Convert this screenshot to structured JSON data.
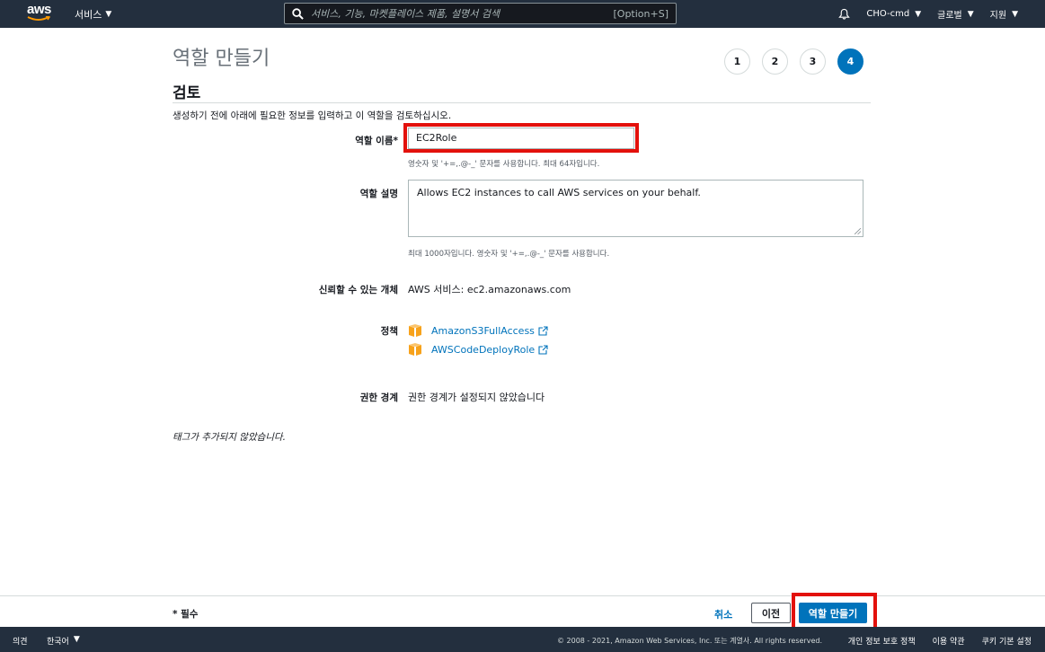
{
  "topnav": {
    "logo_text": "aws",
    "services_label": "서비스",
    "search_placeholder": "서비스, 기능, 마켓플레이스 제품, 설명서 검색",
    "search_shortcut": "[Option+S]",
    "account": "CHO-cmd",
    "region": "글로벌",
    "support": "지원"
  },
  "page": {
    "title": "역할 만들기",
    "steps": [
      "1",
      "2",
      "3",
      "4"
    ],
    "active_step": "4",
    "section_title": "검토",
    "intro": "생성하기 전에 아래에 필요한 정보를 입력하고 이 역할을 검토하십시오."
  },
  "form": {
    "role_name_label": "역할 이름*",
    "role_name_value": "EC2Role",
    "role_name_hint": "영숫자 및 '+=,.@-_' 문자를 사용합니다. 최대 64자입니다.",
    "description_label": "역할 설명",
    "description_value": "Allows EC2 instances to call AWS services on your behalf.",
    "description_hint": "최대 1000자입니다. 영숫자 및 '+=,.@-_' 문자를 사용합니다.",
    "trusted_label": "신뢰할 수 있는 개체",
    "trusted_value": "AWS 서비스: ec2.amazonaws.com",
    "policies_label": "정책",
    "policies": [
      "AmazonS3FullAccess",
      "AWSCodeDeployRole"
    ],
    "boundary_label": "권한 경계",
    "boundary_value": "권한 경계가 설정되지 않았습니다",
    "no_tags": "태그가 추가되지 않았습니다."
  },
  "actions": {
    "required": "* 필수",
    "cancel": "취소",
    "previous": "이전",
    "create": "역할 만들기"
  },
  "footer": {
    "feedback": "의견",
    "language": "한국어",
    "copyright": "© 2008 - 2021, Amazon Web Services, Inc. 또는 계열사. All rights reserved.",
    "privacy": "개인 정보 보호 정책",
    "terms": "이용 약관",
    "cookies": "쿠키 기본 설정"
  },
  "colors": {
    "nav_bg": "#232f3e",
    "accent": "#0073bb",
    "highlight_border": "#e3110c",
    "policy_icon": "#f7a21b"
  }
}
